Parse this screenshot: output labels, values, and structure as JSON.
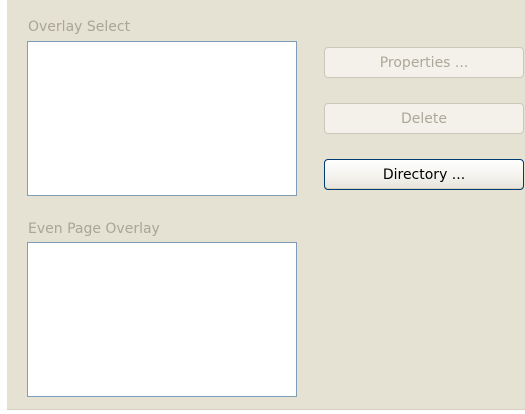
{
  "overlay_select": {
    "label": "Overlay Select",
    "items": []
  },
  "even_page_overlay": {
    "label": "Even Page Overlay",
    "items": []
  },
  "buttons": {
    "properties": "Properties ...",
    "delete": "Delete",
    "directory": "Directory ..."
  },
  "colors": {
    "panel_background": "#e5e1d3",
    "disabled_text": "#aca899",
    "listbox_border": "#7f9db9",
    "active_button_border": "#003c74"
  }
}
